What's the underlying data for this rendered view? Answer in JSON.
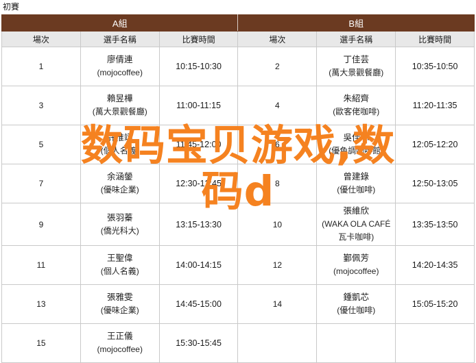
{
  "page": {
    "title": "初賽",
    "watermark_line1": "数码宝贝游戏,数",
    "watermark_line2": "码d",
    "watermark_color": "#f58220",
    "header_color": "#6b3a21",
    "col_header_bg": "#e8e8e8"
  },
  "groups": {
    "a_label": "A組",
    "b_label": "B組"
  },
  "columns": {
    "no": "場次",
    "name": "選手名稱",
    "time": "比賽時間"
  },
  "rows": [
    {
      "a_no": "1",
      "a_name": "廖倩連",
      "a_aff": "(mojocoffee)",
      "a_time": "10:15-10:30",
      "b_no": "2",
      "b_name": "丁佳芸",
      "b_aff": "(萬大景觀餐廳)",
      "b_time": "10:35-10:50"
    },
    {
      "a_no": "3",
      "a_name": "賴昱樺",
      "a_aff": "(萬大景觀餐廳)",
      "a_time": "11:00-11:15",
      "b_no": "4",
      "b_name": "朱紹齊",
      "b_aff": "(歐客佬咖啡)",
      "b_time": "11:20-11:35"
    },
    {
      "a_no": "5",
      "a_name": "許惟翊",
      "a_aff": "(個人名義)",
      "a_time": "11:45-12:00",
      "b_no": "6",
      "b_name": "吳佳芯",
      "b_aff": "(優色調咖啡館)",
      "b_time": "12:05-12:20"
    },
    {
      "a_no": "7",
      "a_name": "余涵鎣",
      "a_aff": "(優味企業)",
      "a_time": "12:30-12:45",
      "b_no": "8",
      "b_name": "曾建錄",
      "b_aff": "(優仕咖啡)",
      "b_time": "12:50-13:05"
    },
    {
      "a_no": "9",
      "a_name": "張羽蓁",
      "a_aff": "(僑光科大)",
      "a_time": "13:15-13:30",
      "b_no": "10",
      "b_name": "張維欣",
      "b_aff": "(WAKA OLA CAFÉ 瓦卡咖啡)",
      "b_time": "13:35-13:50"
    },
    {
      "a_no": "11",
      "a_name": "王聖偉",
      "a_aff": "(個人名義)",
      "a_time": "14:00-14:15",
      "b_no": "12",
      "b_name": "鄞佩芳",
      "b_aff": "(mojocoffee)",
      "b_time": "14:20-14:35"
    },
    {
      "a_no": "13",
      "a_name": "張雅雯",
      "a_aff": "(優味企業)",
      "a_time": "14:45-15:00",
      "b_no": "14",
      "b_name": "鍾凱芯",
      "b_aff": "(優仕咖啡)",
      "b_time": "15:05-15:20"
    },
    {
      "a_no": "15",
      "a_name": "王正儀",
      "a_aff": "(mojocoffee)",
      "a_time": "15:30-15:45",
      "b_no": "",
      "b_name": "",
      "b_aff": "",
      "b_time": ""
    }
  ]
}
